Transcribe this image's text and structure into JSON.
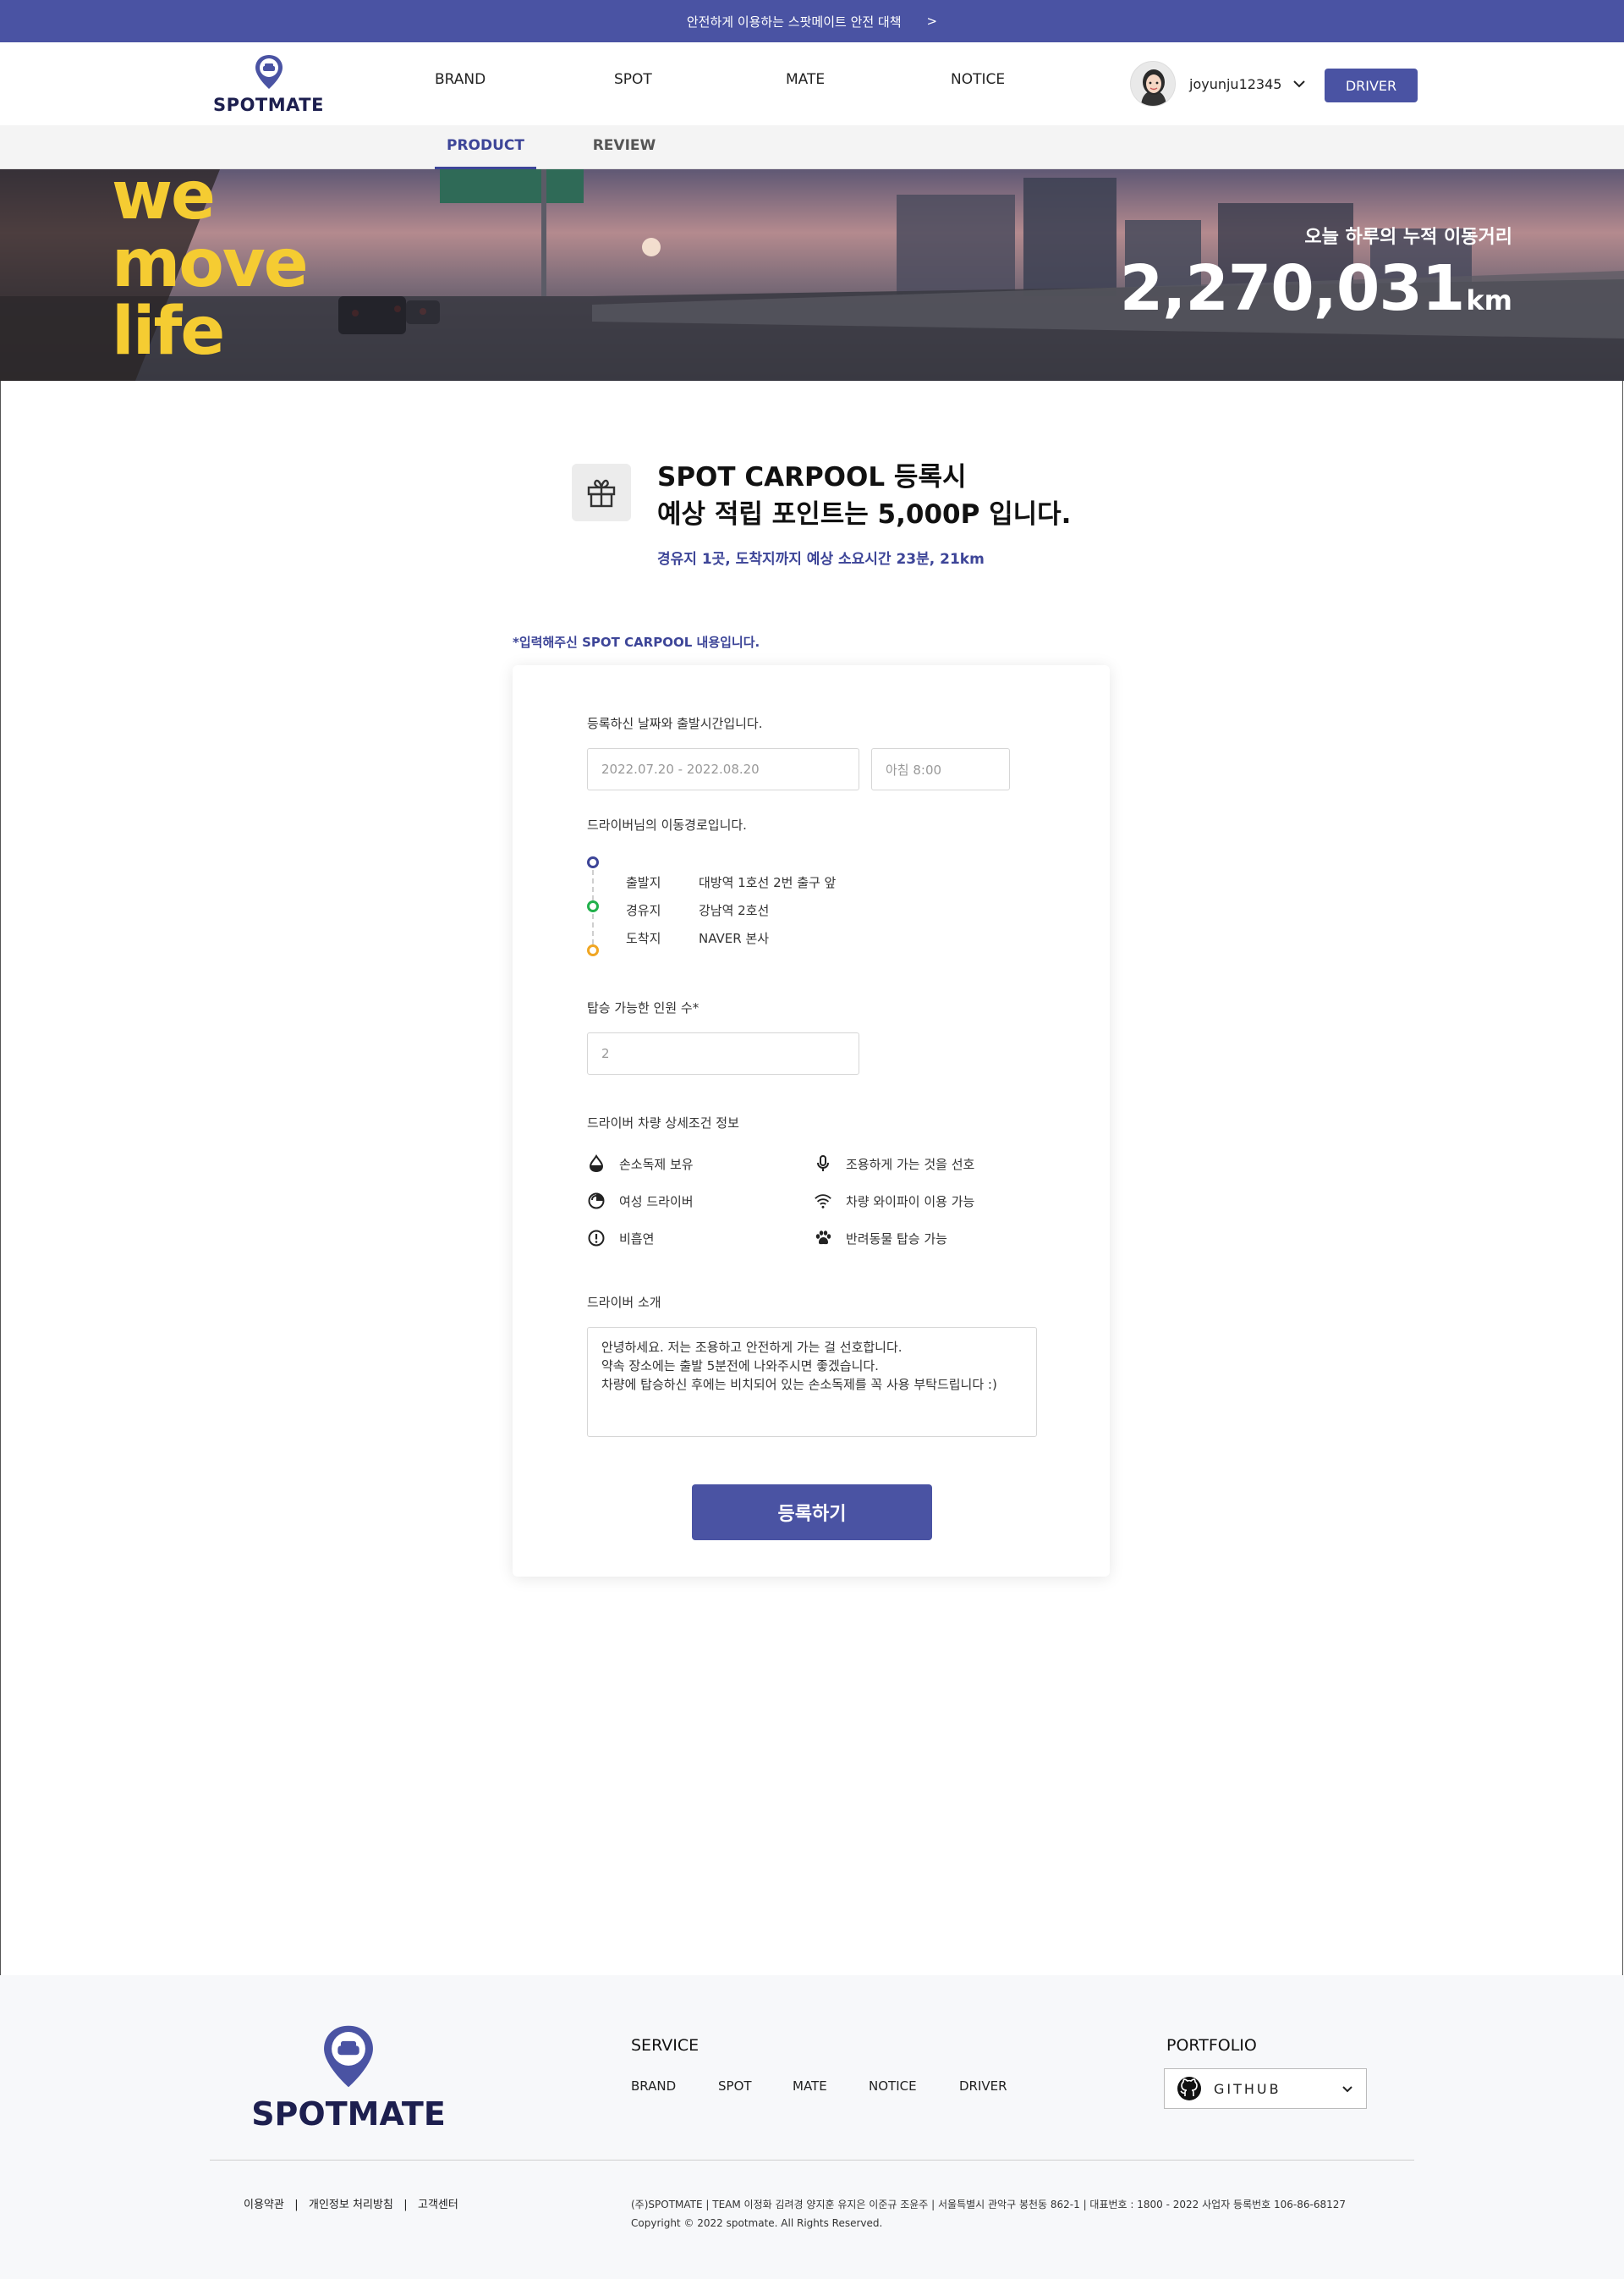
{
  "topbar": {
    "notice": "안전하게 이용하는 스팟메이트 안전 대책",
    "arrow": ">"
  },
  "header": {
    "logo_text": "SPOTMATE",
    "nav": [
      "BRAND",
      "SPOT",
      "MATE",
      "NOTICE"
    ],
    "username": "joyunju12345",
    "driver_button": "DRIVER"
  },
  "subnav": {
    "tabs": [
      "PRODUCT",
      "REVIEW"
    ],
    "active": "PRODUCT"
  },
  "hero": {
    "slogan": [
      "we",
      "move",
      "life"
    ],
    "caption": "오늘 하루의 누적 이동거리",
    "distance": "2,270,031",
    "unit": "km"
  },
  "intro": {
    "title_line1": "SPOT CARPOOL 등록시",
    "title_line2": "예상 적립 포인트는 5,000P 입니다.",
    "subtitle": "경유지 1곳, 도착지까지 예상 소요시간 23분, 21km"
  },
  "form": {
    "note": "*입력해주신 SPOT CARPOOL 내용입니다.",
    "date_label": "등록하신 날짜와 출발시간입니다.",
    "date_value": "2022.07.20 - 2022.08.20",
    "time_value": "아침 8:00",
    "route_label": "드라이버님의 이동경로입니다.",
    "route": [
      {
        "type": "출발지",
        "place": "대방역 1호선 2번 출구 앞",
        "color": "#3d4598"
      },
      {
        "type": "경유지",
        "place": "강남역 2호선",
        "color": "#22b14c"
      },
      {
        "type": "도착지",
        "place": "NAVER 본사",
        "color": "#f0a623"
      }
    ],
    "passengers_label": "탑승 가능한 인원 수*",
    "passengers_value": "2",
    "options_label": "드라이버 차량 상세조건 정보",
    "options": [
      {
        "icon": "sanitizer-icon",
        "label": "손소독제 보유"
      },
      {
        "icon": "microphone-icon",
        "label": "조용하게 가는 것을 선호"
      },
      {
        "icon": "female-icon",
        "label": "여성 드라이버"
      },
      {
        "icon": "wifi-icon",
        "label": "차량 와이파이 이용 가능"
      },
      {
        "icon": "no-smoking-icon",
        "label": "비흡연"
      },
      {
        "icon": "paw-icon",
        "label": "반려동물 탑승 가능"
      }
    ],
    "intro_label": "드라이버 소개",
    "intro_text": "안녕하세요. 저는 조용하고 안전하게 가는 걸 선호합니다.\n약속 장소에는 출발 5분전에 나와주시면 좋겠습니다.\n차량에 탑승하신 후에는 비치되어 있는 손소독제를 꼭 사용 부탁드립니다 :)",
    "submit": "등록하기"
  },
  "footer": {
    "logo_text": "SPOTMATE",
    "service_heading": "SERVICE",
    "service_links": [
      "BRAND",
      "SPOT",
      "MATE",
      "NOTICE",
      "DRIVER"
    ],
    "portfolio_heading": "PORTFOLIO",
    "github_label": "GITHUB",
    "legal_links": "이용약관   |   개인정보 처리방침   |   고객센터",
    "company_info": "(주)SPOTMATE | TEAM 이정화 김려경 양지훈 유지은 이준규 조윤주 | 서울특별시 관악구 봉천동 862-1 | 대표번호 : 1800 - 2022 사업자 등록번호 106-86-68127",
    "copyright": "Copyright © 2022 spotmate. All Rights Reserved."
  },
  "colors": {
    "brand": "#4a53a3",
    "accent_yellow": "#f5cc32",
    "navy": "#1d1f4f"
  }
}
